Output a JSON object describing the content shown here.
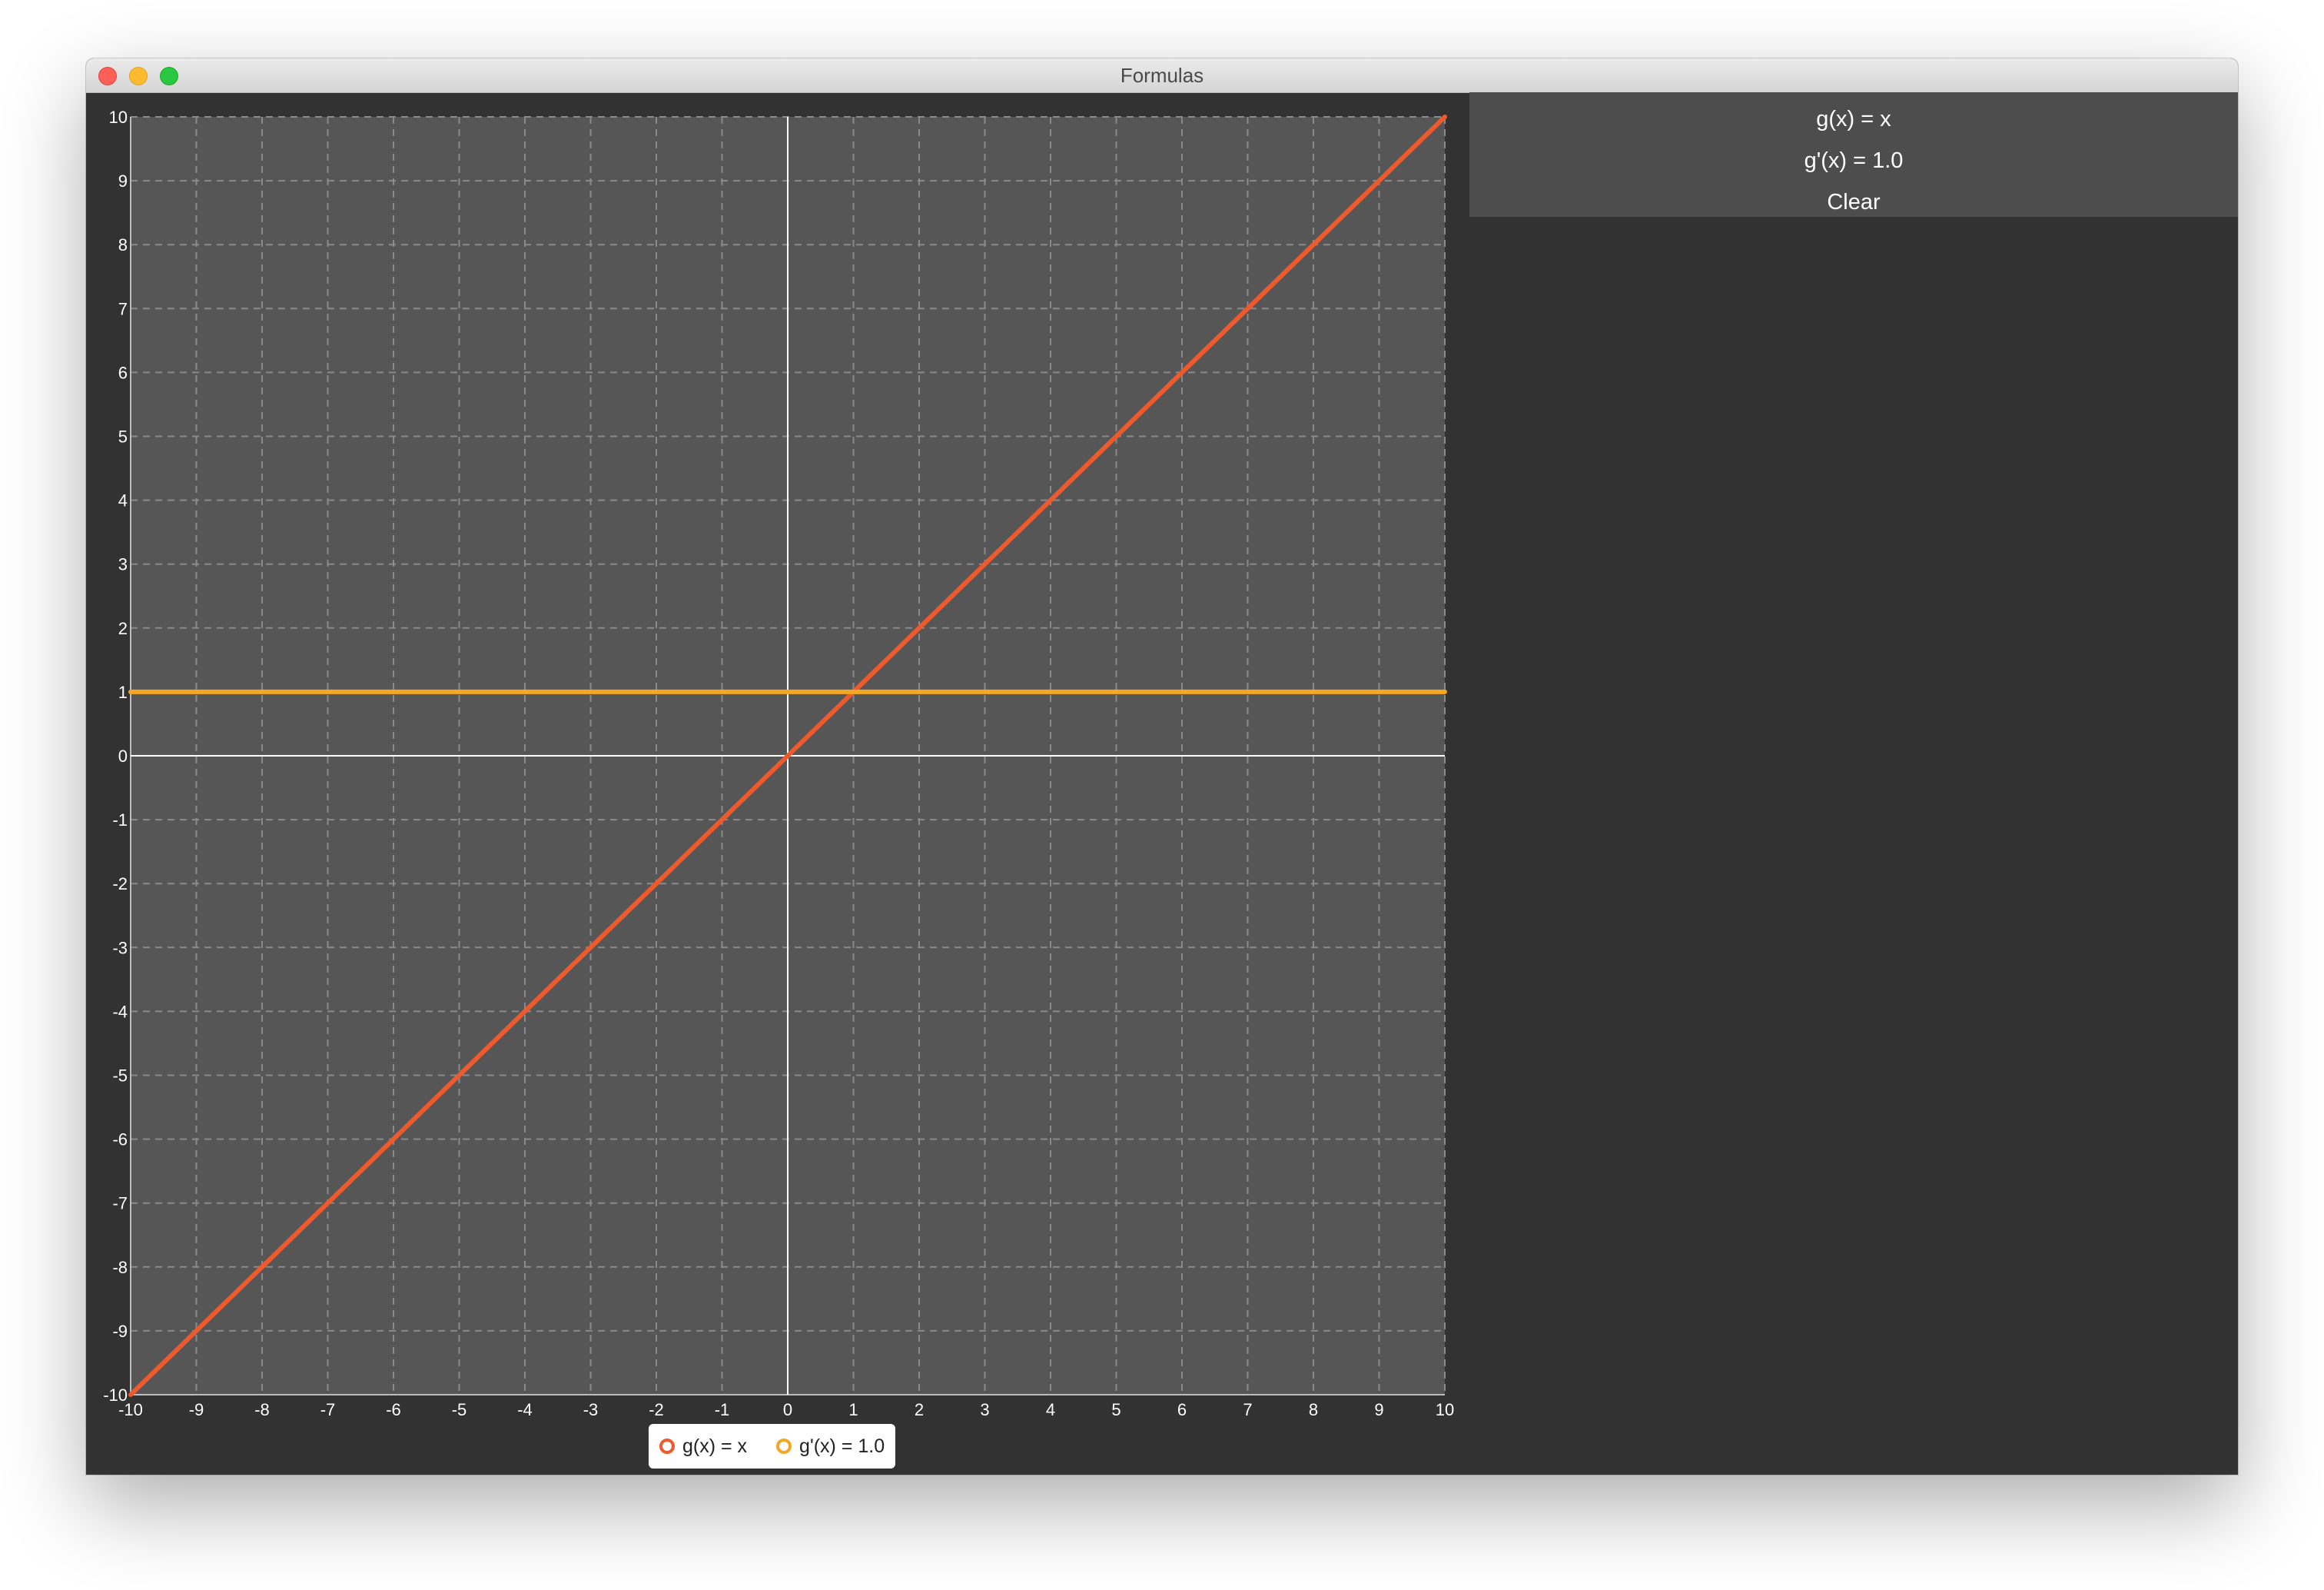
{
  "window": {
    "title": "Formulas"
  },
  "formula_panel": {
    "function_label": "g(x) = x",
    "derivative_label": "g'(x) = 1.0",
    "clear_label": "Clear"
  },
  "legend": [
    {
      "label": "g(x) = x",
      "color": "#ee5a2c"
    },
    {
      "label": "g'(x) = 1.0",
      "color": "#f5a623"
    }
  ],
  "colors": {
    "plot_background": "#565656",
    "window_background": "#323232",
    "grid": "#8a8a8a",
    "axis": "#ffffff"
  },
  "chart_data": {
    "type": "line",
    "xlim": [
      -10,
      10
    ],
    "ylim": [
      -10,
      10
    ],
    "x_ticks": [
      "-10",
      "-9",
      "-8",
      "-7",
      "-6",
      "-5",
      "-4",
      "-3",
      "-2",
      "-1",
      "0",
      "1",
      "2",
      "3",
      "4",
      "5",
      "6",
      "7",
      "8",
      "9",
      "10"
    ],
    "y_ticks": [
      "10",
      "9",
      "8",
      "7",
      "6",
      "5",
      "4",
      "3",
      "2",
      "1",
      "0",
      "-1",
      "-2",
      "-3",
      "-4",
      "-5",
      "-6",
      "-7",
      "-8",
      "-9",
      "-10"
    ],
    "grid": true,
    "legend_position": "bottom-center",
    "series": [
      {
        "name": "g(x) = x",
        "color": "#ee5a2c",
        "x": [
          -10,
          10
        ],
        "y": [
          -10,
          10
        ]
      },
      {
        "name": "g'(x) = 1.0",
        "color": "#f5a623",
        "x": [
          -10,
          10
        ],
        "y": [
          1,
          1
        ]
      }
    ]
  }
}
